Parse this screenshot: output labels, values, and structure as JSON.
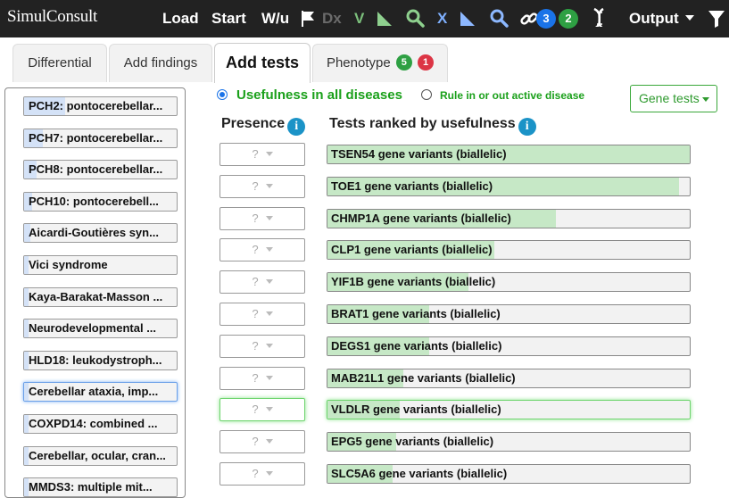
{
  "topbar": {
    "logo": "SimulConsult",
    "load": "Load",
    "start": "Start",
    "wu": "W/u",
    "dx": "Dx",
    "v": "V",
    "x": "X",
    "badge_blue": "3",
    "badge_green": "2",
    "output": "Output",
    "colors": {
      "bg": "#222222",
      "accent_green": "#4caf50",
      "badge_blue": "#1a73e8"
    }
  },
  "tabs": {
    "differential": "Differential",
    "add_findings": "Add findings",
    "add_tests": "Add tests",
    "phenotype": "Phenotype",
    "phenotype_badge_green": "5",
    "phenotype_badge_red": "1"
  },
  "diagnoses": [
    {
      "label": "PCH2: pontocerebellar...",
      "level": 0.27
    },
    {
      "label": "PCH7: pontocerebellar...",
      "level": 0.12
    },
    {
      "label": "PCH8: pontocerebellar...",
      "level": 0.08
    },
    {
      "label": "PCH10: pontocerebell...",
      "level": 0.05
    },
    {
      "label": "Aicardi-Goutières syn...",
      "level": 0.04
    },
    {
      "label": "Vici syndrome",
      "level": 0.03
    },
    {
      "label": "Kaya-Barakat-Masson ...",
      "level": 0.03
    },
    {
      "label": "Neurodevelopmental ...",
      "level": 0.03
    },
    {
      "label": "HLD18: leukodystroph...",
      "level": 0.03
    },
    {
      "label": "Cerebellar ataxia, imp...",
      "level": 0.03,
      "selected": true
    },
    {
      "label": "COXPD14: combined ...",
      "level": 0.03
    },
    {
      "label": "Cerebellar, ocular, cran...",
      "level": 0.03
    },
    {
      "label": "MMDS3: multiple mit...",
      "level": 0.03
    }
  ],
  "options": {
    "usefulness_all": "Usefulness in all diseases",
    "rule_in_out": "Rule in or out active disease",
    "gene_tests": "Gene tests"
  },
  "columns": {
    "presence": "Presence",
    "tests_ranked": "Tests ranked by usefulness",
    "info": "i"
  },
  "presence_placeholder": "?",
  "tests": [
    {
      "label": "TSEN54 gene variants (biallelic)",
      "usefulness": 1.0
    },
    {
      "label": "TOE1 gene variants (biallelic)",
      "usefulness": 0.97
    },
    {
      "label": "CHMP1A gene variants (biallelic)",
      "usefulness": 0.63
    },
    {
      "label": "CLP1 gene variants (biallelic)",
      "usefulness": 0.46
    },
    {
      "label": "YIF1B gene variants (biallelic)",
      "usefulness": 0.39
    },
    {
      "label": "BRAT1 gene variants (biallelic)",
      "usefulness": 0.28
    },
    {
      "label": "DEGS1 gene variants (biallelic)",
      "usefulness": 0.28
    },
    {
      "label": "MAB21L1 gene variants (biallelic)",
      "usefulness": 0.21
    },
    {
      "label": "VLDLR gene variants (biallelic)",
      "usefulness": 0.2,
      "highlight": true
    },
    {
      "label": "EPG5 gene variants (biallelic)",
      "usefulness": 0.19
    },
    {
      "label": "SLC5A6 gene variants (biallelic)",
      "usefulness": 0.18
    }
  ]
}
